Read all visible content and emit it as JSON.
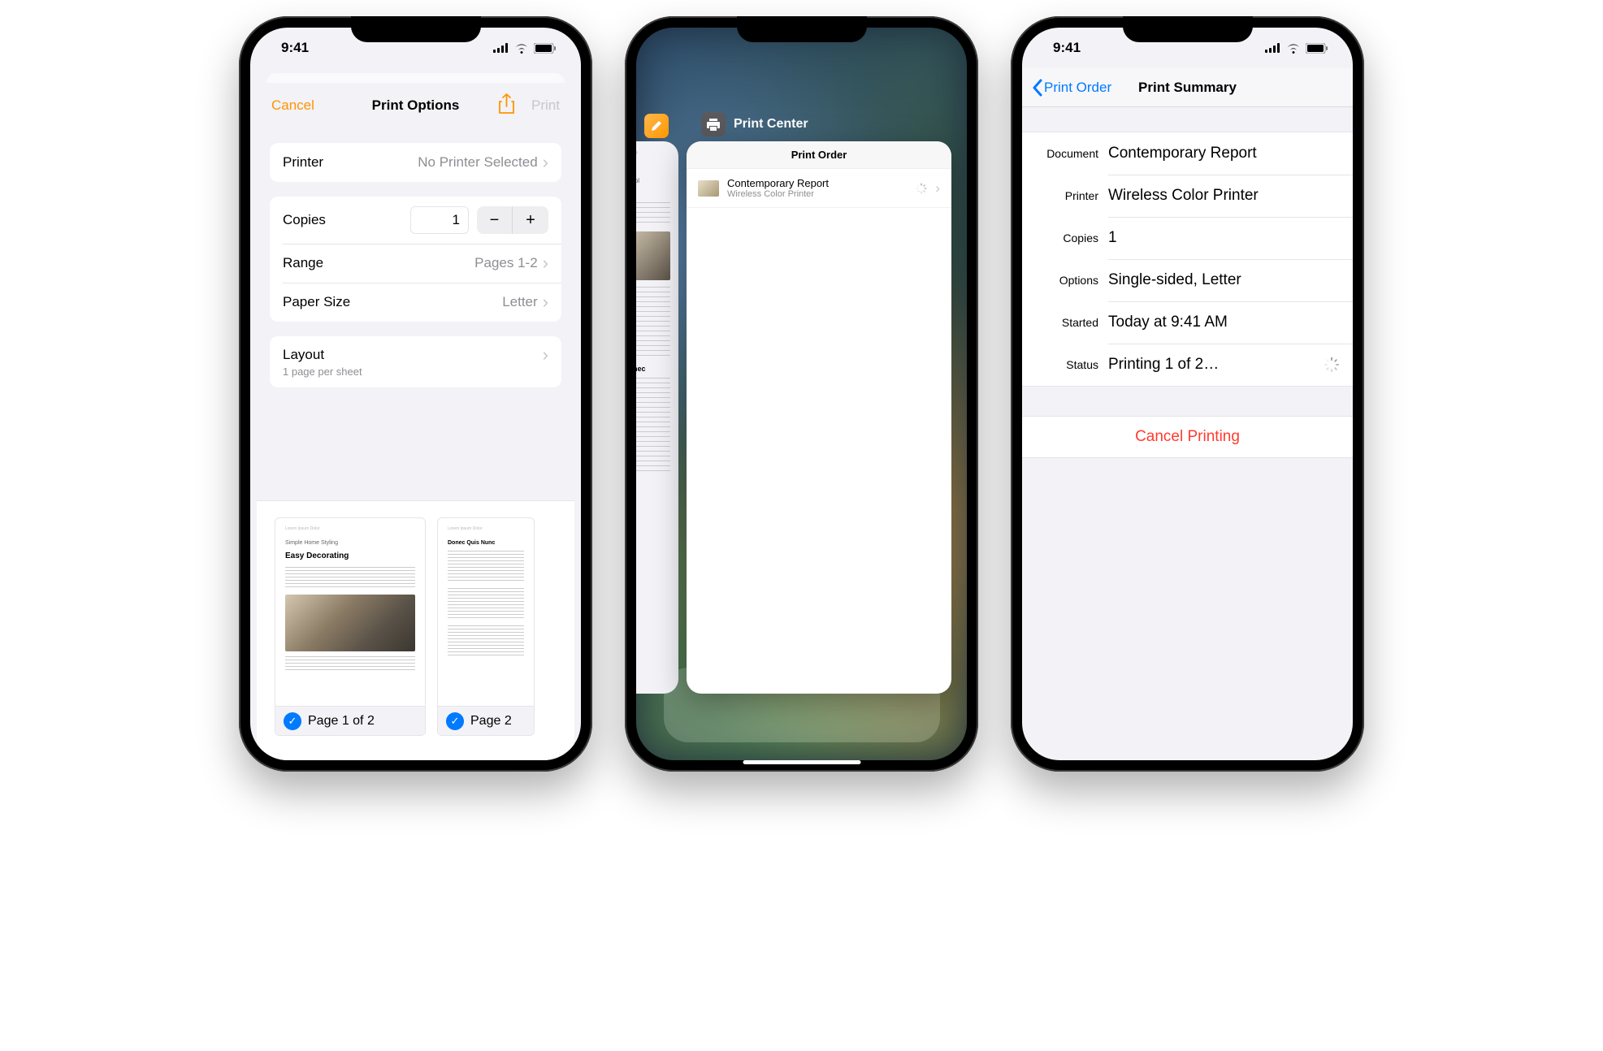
{
  "status": {
    "time": "9:41"
  },
  "screen1": {
    "cancel": "Cancel",
    "title": "Print Options",
    "print": "Print",
    "printer_label": "Printer",
    "printer_value": "No Printer Selected",
    "copies_label": "Copies",
    "copies_value": "1",
    "range_label": "Range",
    "range_value": "Pages 1-2",
    "paper_label": "Paper Size",
    "paper_value": "Letter",
    "layout_label": "Layout",
    "layout_sub": "1 page per sheet",
    "thumbs": [
      {
        "badge": "Page 1 of 2",
        "small_title": "Simple Home Styling",
        "heading": "Easy Decorating"
      },
      {
        "badge": "Page 2",
        "heading": "Donec Quis Nunc"
      }
    ]
  },
  "screen2": {
    "app_name": "Print Center",
    "card_title": "Print Order",
    "item_title": "Contemporary Report",
    "item_sub": "Wireless Color Printer",
    "back_card": {
      "small": "Simpl",
      "head": "Ea",
      "sub2": "Donec"
    }
  },
  "screen3": {
    "back": "Print Order",
    "title": "Print Summary",
    "rows": {
      "document_label": "Document",
      "document_value": "Contemporary Report",
      "printer_label": "Printer",
      "printer_value": "Wireless Color Printer",
      "copies_label": "Copies",
      "copies_value": "1",
      "options_label": "Options",
      "options_value": "Single-sided, Letter",
      "started_label": "Started",
      "started_value": "Today at  9:41 AM",
      "status_label": "Status",
      "status_value": "Printing 1 of 2…"
    },
    "cancel": "Cancel Printing"
  }
}
